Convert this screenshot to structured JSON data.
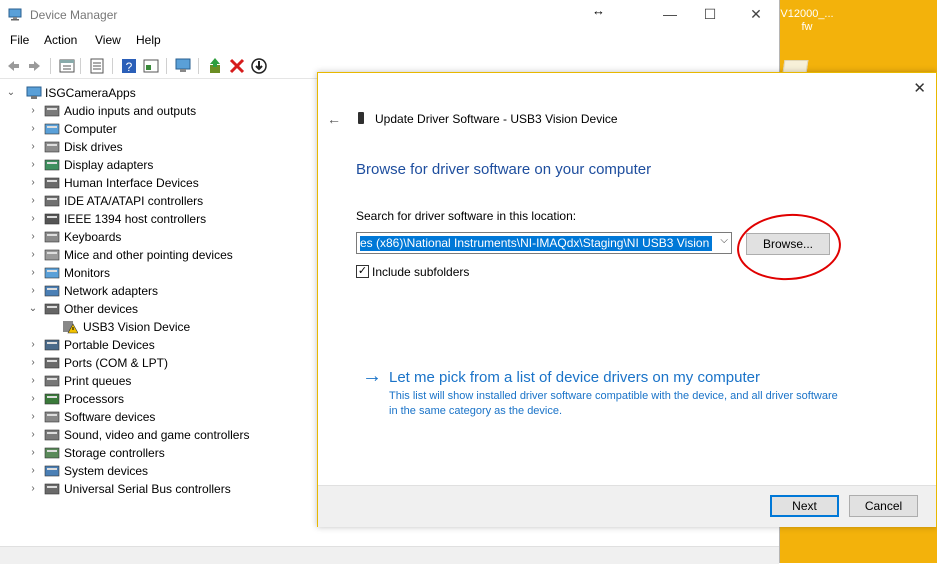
{
  "desktop": {
    "label": "V12000_... fw"
  },
  "window": {
    "title": "Device Manager",
    "resize_glyph": "↔",
    "minimize": "—",
    "maximize": "☐",
    "close": "✕"
  },
  "menu": [
    "File",
    "Action",
    "View",
    "Help"
  ],
  "tree": {
    "root": "ISGCameraApps",
    "items": [
      {
        "label": "Audio inputs and outputs",
        "icon": "speaker-icon",
        "expanded": false
      },
      {
        "label": "Computer",
        "icon": "monitor-icon",
        "expanded": false
      },
      {
        "label": "Disk drives",
        "icon": "disk-icon",
        "expanded": false
      },
      {
        "label": "Display adapters",
        "icon": "display-adapter-icon",
        "expanded": false
      },
      {
        "label": "Human Interface Devices",
        "icon": "hid-icon",
        "expanded": false
      },
      {
        "label": "IDE ATA/ATAPI controllers",
        "icon": "ide-icon",
        "expanded": false
      },
      {
        "label": "IEEE 1394 host controllers",
        "icon": "firewire-icon",
        "expanded": false
      },
      {
        "label": "Keyboards",
        "icon": "keyboard-icon",
        "expanded": false
      },
      {
        "label": "Mice and other pointing devices",
        "icon": "mouse-icon",
        "expanded": false
      },
      {
        "label": "Monitors",
        "icon": "monitor-icon",
        "expanded": false
      },
      {
        "label": "Network adapters",
        "icon": "network-icon",
        "expanded": false
      },
      {
        "label": "Other devices",
        "icon": "unknown-device-icon",
        "expanded": true
      },
      {
        "label": "USB3 Vision Device",
        "icon": "warning-device-icon",
        "child": true
      },
      {
        "label": "Portable Devices",
        "icon": "portable-icon",
        "expanded": false
      },
      {
        "label": "Ports (COM & LPT)",
        "icon": "port-icon",
        "expanded": false
      },
      {
        "label": "Print queues",
        "icon": "printer-icon",
        "expanded": false
      },
      {
        "label": "Processors",
        "icon": "cpu-icon",
        "expanded": false
      },
      {
        "label": "Software devices",
        "icon": "software-device-icon",
        "expanded": false
      },
      {
        "label": "Sound, video and game controllers",
        "icon": "speaker-icon",
        "expanded": false
      },
      {
        "label": "Storage controllers",
        "icon": "storage-icon",
        "expanded": false
      },
      {
        "label": "System devices",
        "icon": "system-icon",
        "expanded": false
      },
      {
        "label": "Universal Serial Bus controllers",
        "icon": "usb-icon",
        "expanded": false
      }
    ]
  },
  "dialog": {
    "title": "Update Driver Software - USB3 Vision Device",
    "close": "✕",
    "back": "←",
    "heading": "Browse for driver software on your computer",
    "search_label": "Search for driver software in this location:",
    "path_value": "es (x86)\\National Instruments\\NI-IMAQdx\\Staging\\NI USB3 Vision",
    "browse_label": "Browse...",
    "include_subfolders_label": "Include subfolders",
    "include_subfolders_checked": "✓",
    "pick_arrow": "→",
    "pick_title": "Let me pick from a list of device drivers on my computer",
    "pick_desc": "This list will show installed driver software compatible with the device, and all driver software in the same category as the device.",
    "next_label": "Next",
    "cancel_label": "Cancel"
  },
  "colors": {
    "accent": "#1a73c8",
    "heading": "#1e4e9e",
    "selection": "#0078d7",
    "annotation": "#e00000",
    "desktop": "#f3b20b"
  }
}
